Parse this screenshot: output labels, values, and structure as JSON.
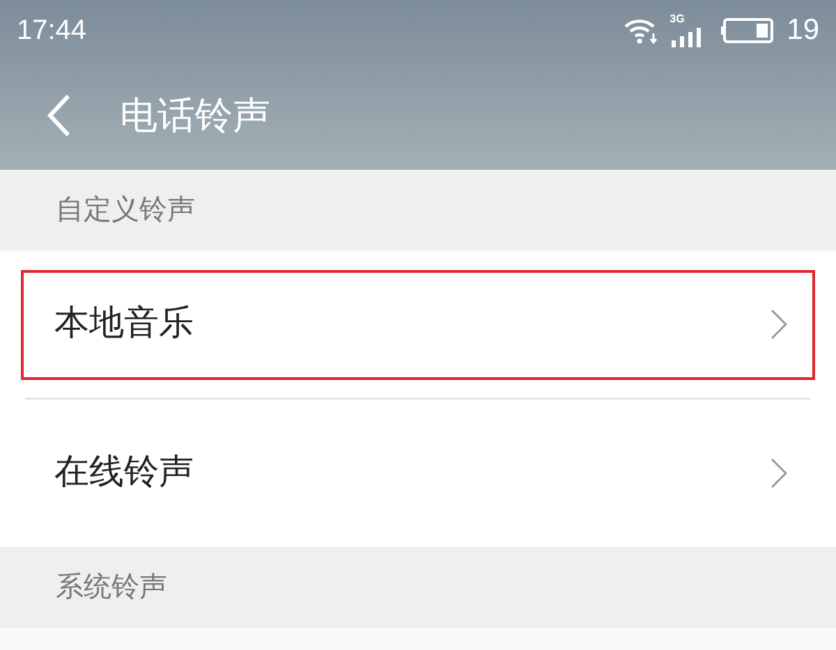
{
  "status_bar": {
    "time": "17:44",
    "network": "3G",
    "battery": "19"
  },
  "header": {
    "title": "电话铃声"
  },
  "sections": [
    {
      "title": "自定义铃声",
      "items": [
        {
          "label": "本地音乐",
          "highlighted": true
        },
        {
          "label": "在线铃声",
          "highlighted": false
        }
      ]
    },
    {
      "title": "系统铃声"
    }
  ]
}
